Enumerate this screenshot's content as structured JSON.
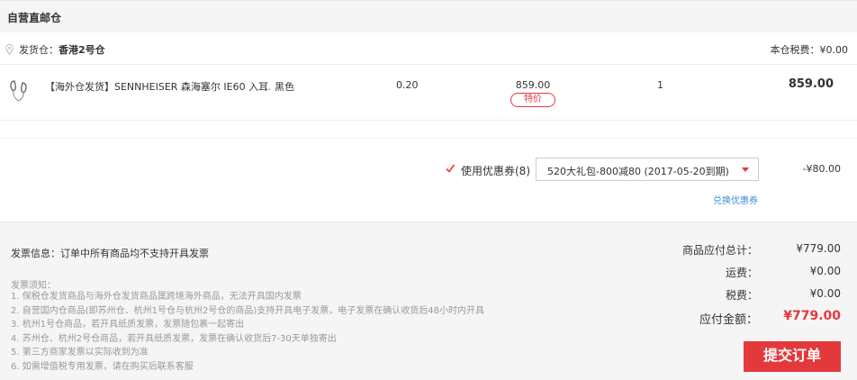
{
  "section": {
    "title": "自营直邮仓"
  },
  "warehouse": {
    "label": "发货仓：",
    "name": "香港2号仓",
    "tax_label": "本仓税费：",
    "tax_value": "¥0.00"
  },
  "product": {
    "name": "【海外仓发货】SENNHEISER 森海塞尔 IE60 入耳...",
    "color": "黑色",
    "weight": "0.20",
    "price": "859.00",
    "badge": "特价",
    "quantity": "1",
    "subtotal": "859.00"
  },
  "coupon": {
    "label": "使用优惠券(8)",
    "selected": "520大礼包-800减80 (2017-05-20到期)",
    "discount": "-¥80.00",
    "exchange_link": "兑换优惠券",
    "checked": true
  },
  "invoice": {
    "info": "发票信息：订单中所有商品均不支持开具发票",
    "notice_title": "发票须知：",
    "notices": [
      "1. 保税仓发货商品与海外仓发货商品属跨境海外商品，无法开具国内发票",
      "2. 自营国内仓商品(即苏州仓、杭州1号仓与杭州2号仓的商品)支持开具电子发票，电子发票在确认收货后48小时内开具",
      "3. 杭州1号仓商品，若开具纸质发票，发票随包裹一起寄出",
      "4. 苏州仓、杭州2号仓商品，若开具纸质发票，发票在确认收货后7-30天单独寄出",
      "5. 第三方商家发票以实际收到为准",
      "6. 如需增值税专用发票，请在购买后联系客服"
    ]
  },
  "summary": {
    "goods_total_label": "商品应付总计：",
    "goods_total_value": "¥779.00",
    "shipping_label": "运费：",
    "shipping_value": "¥0.00",
    "tax_label": "税费：",
    "tax_value": "¥0.00",
    "payable_label": "应付金额：",
    "payable_value": "¥779.00",
    "submit_label": "提交订单"
  },
  "colors": {
    "accent": "#e4393c",
    "link": "#3c8fd6",
    "panel": "#f5f5f5"
  }
}
